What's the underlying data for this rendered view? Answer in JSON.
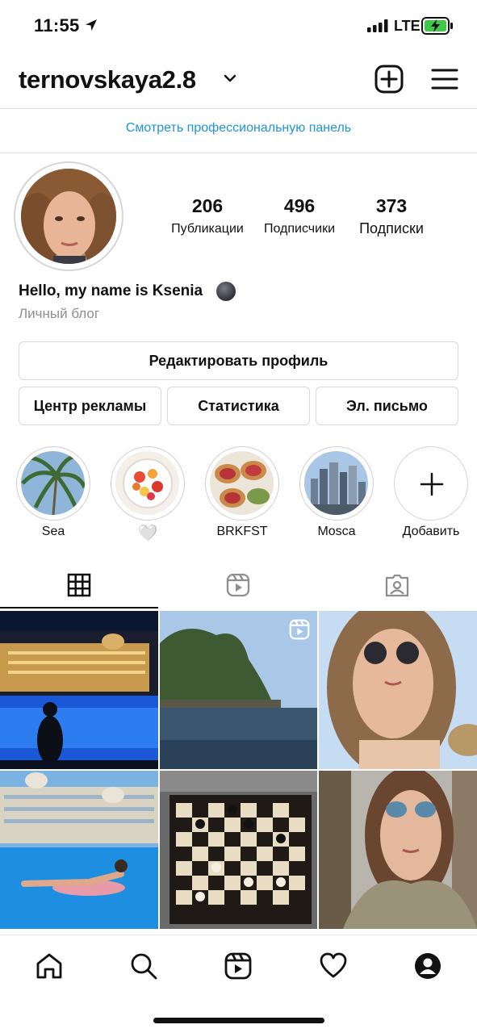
{
  "status_bar": {
    "time": "11:55",
    "network": "LTE"
  },
  "header": {
    "username": "ternovskaya2.8"
  },
  "pro_link": "Смотреть профессиональную панель",
  "stats": [
    {
      "value": "206",
      "label": "Публикации"
    },
    {
      "value": "496",
      "label": "Подписчики"
    },
    {
      "value": "373",
      "label": "Подписки"
    }
  ],
  "bio": {
    "name": "Hello, my name is Ksenia",
    "category": "Личный блог"
  },
  "buttons": {
    "edit_profile": "Редактировать профиль",
    "ad_center": "Центр рекламы",
    "statistics": "Статистика",
    "email": "Эл. письмо"
  },
  "highlights": [
    {
      "label": "Sea"
    },
    {
      "label": "🤍"
    },
    {
      "label": "BRKFST"
    },
    {
      "label": "Mosca"
    },
    {
      "label": "Добавить"
    }
  ],
  "icons": {
    "status": [
      "location-arrow-icon",
      "signal-icon",
      "battery-charging-icon"
    ],
    "header": [
      "chevron-down-icon",
      "add-post-icon",
      "menu-icon"
    ],
    "tabs": [
      "grid-icon",
      "reels-icon",
      "tagged-icon"
    ],
    "nav": [
      "home-icon",
      "search-icon",
      "reels-icon",
      "heart-icon",
      "profile-icon"
    ]
  },
  "colors": {
    "accent": "#1e94da",
    "text": "#111111",
    "secondary": "#8e8e8e"
  }
}
